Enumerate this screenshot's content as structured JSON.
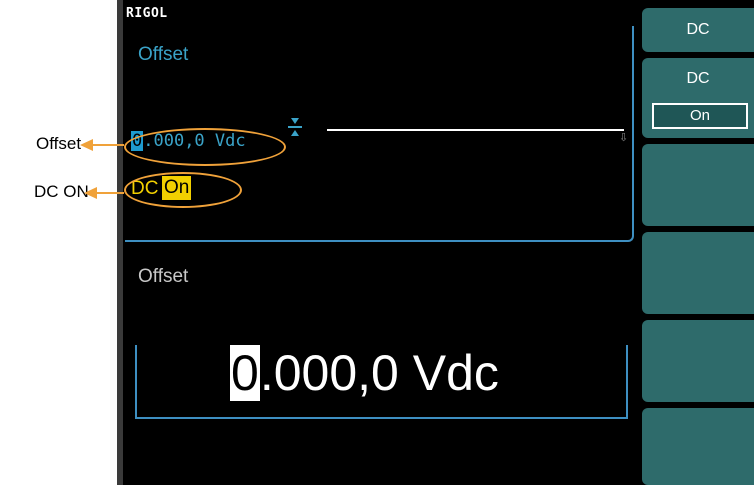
{
  "annotations": {
    "offset_label": "Offset",
    "dc_on_label": "DC ON"
  },
  "screen": {
    "brand": "RIGOL",
    "upper_title": "Offset",
    "offset_value": {
      "cursor_digit": "0",
      "rest": ".000,0 Vdc"
    },
    "dc_label": "DC",
    "dc_state": "On",
    "lower_title": "Offset",
    "big_value": {
      "cursor_digit": "0",
      "rest": ".000,0 Vdc"
    }
  },
  "softkeys": {
    "key1_label": "DC",
    "key2_label": "DC",
    "key2_option": "On"
  },
  "colors": {
    "accent_cyan": "#3aa3c8",
    "softkey_teal": "#2e6b6b",
    "dc_yellow": "#f2d000",
    "callout_orange": "#f0a23a"
  }
}
